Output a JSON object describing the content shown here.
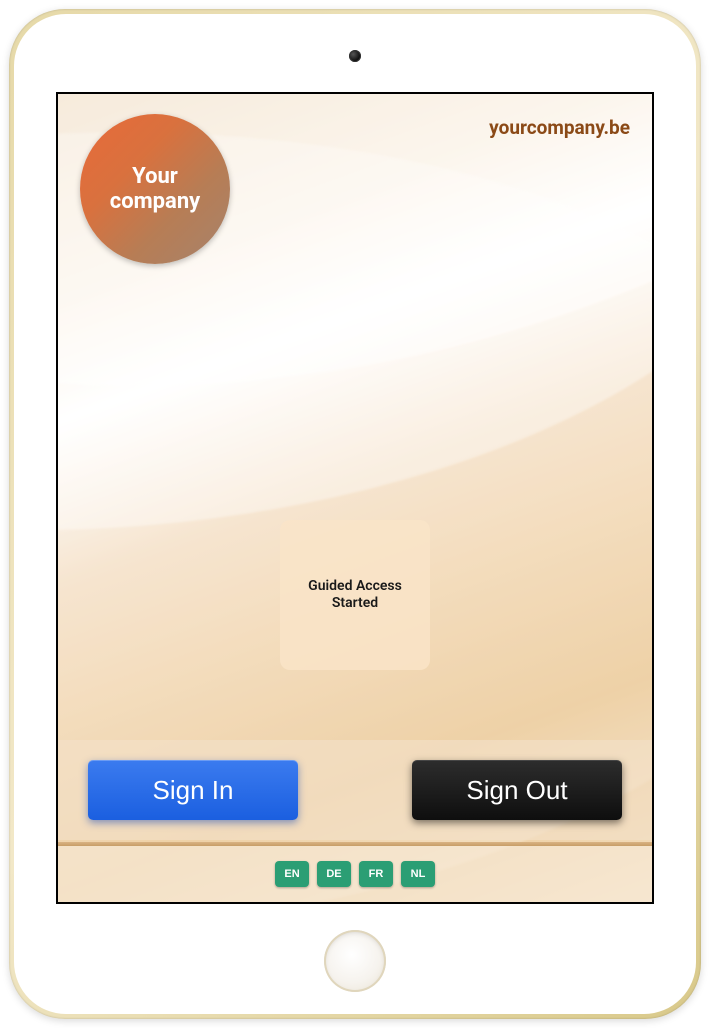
{
  "logo": {
    "line1": "Your",
    "line2": "company"
  },
  "website": "yourcompany.be",
  "toast": {
    "message": "Guided Access Started"
  },
  "actions": {
    "signin_label": "Sign In",
    "signout_label": "Sign Out"
  },
  "languages": [
    {
      "code": "EN"
    },
    {
      "code": "DE"
    },
    {
      "code": "FR"
    },
    {
      "code": "NL"
    }
  ]
}
